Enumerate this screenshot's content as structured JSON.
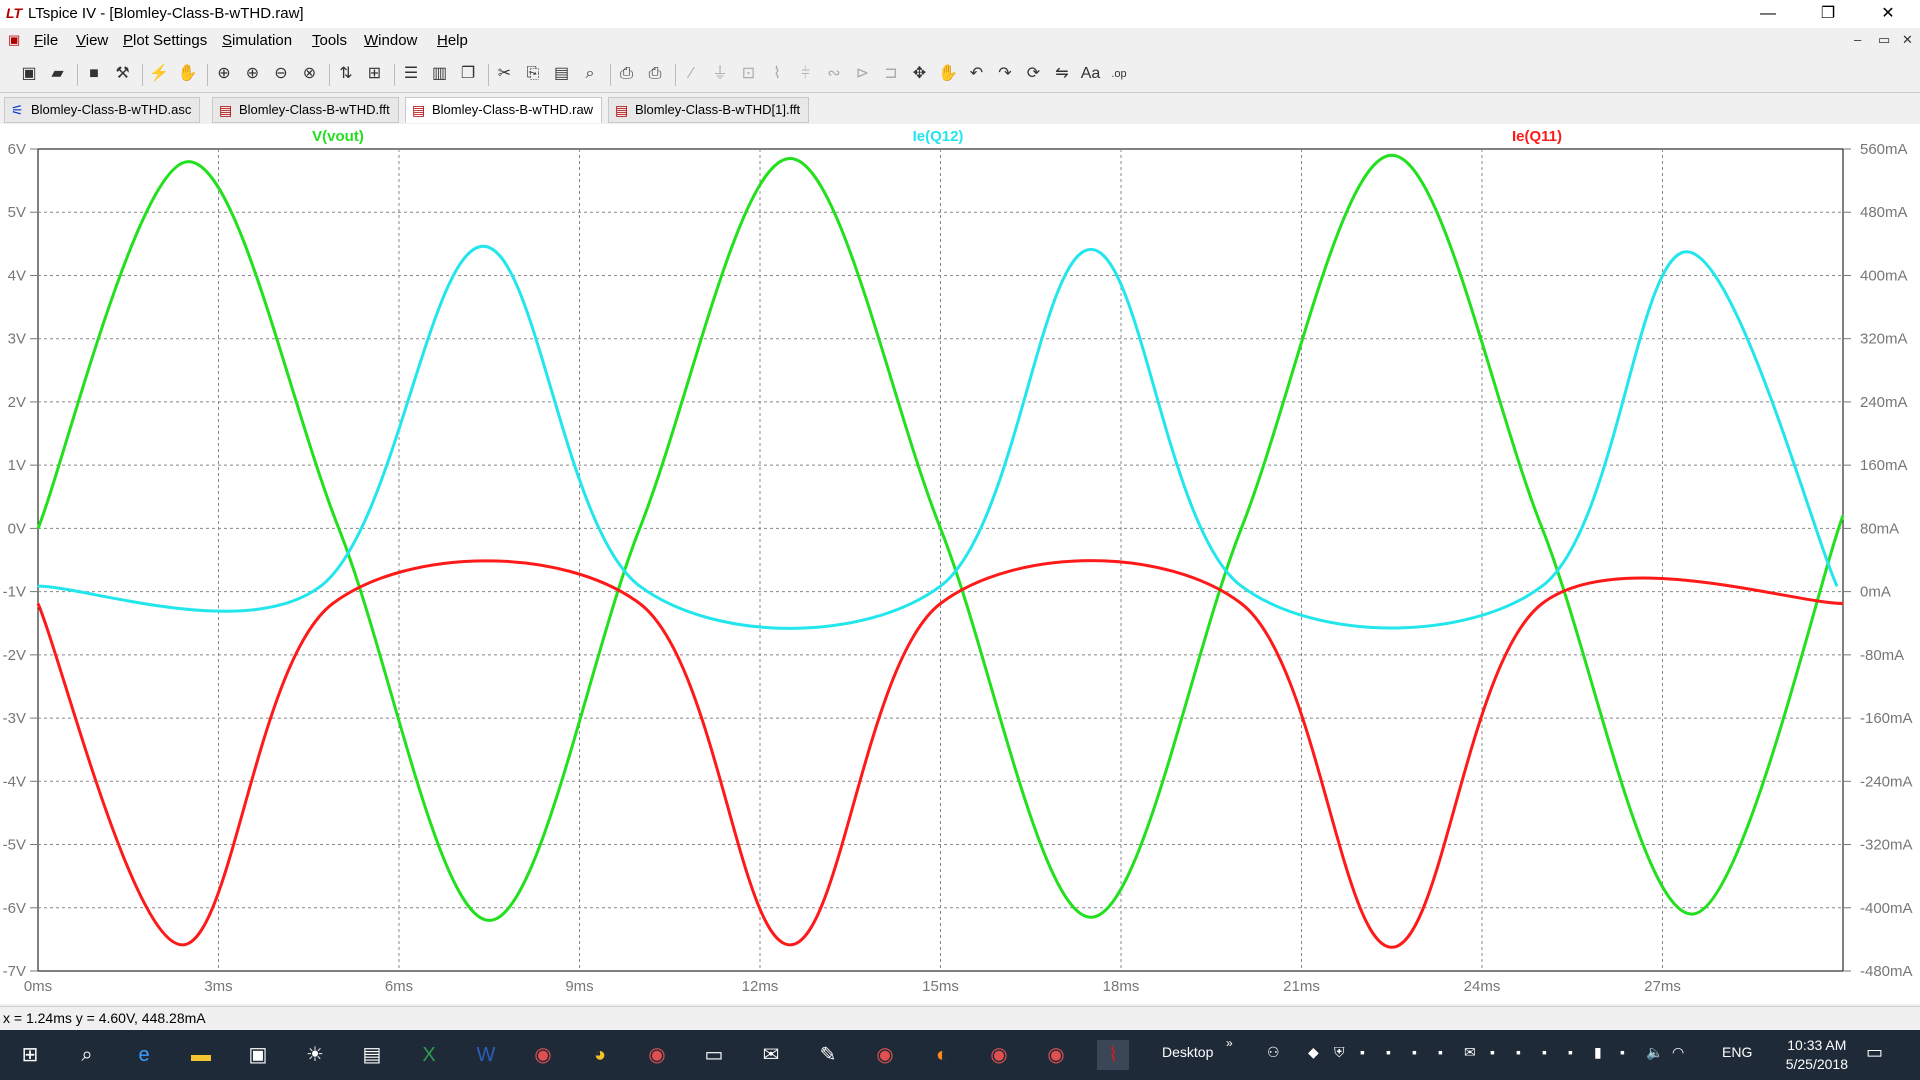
{
  "window": {
    "app_icon": "ltspice-logo-icon",
    "title": "LTspice IV - [Blomley-Class-B-wTHD.raw]",
    "controls": [
      "—",
      "❐",
      "✕"
    ]
  },
  "menu": {
    "items": [
      "File",
      "View",
      "Plot Settings",
      "Simulation",
      "Tools",
      "Window",
      "Help"
    ],
    "mdi_controls": [
      "–",
      "▭",
      "✕"
    ]
  },
  "toolbar": {
    "icons": [
      "new-schematic-icon",
      "open-icon",
      "save-icon",
      "control-panel-icon",
      "run-icon",
      "halt-icon",
      "zoom-in-icon",
      "zoom-in-icon",
      "zoom-out-icon",
      "zoom-fit-icon",
      "autorange-icon",
      "plot-pane-icon",
      "tile-horizontal-icon",
      "tile-vertical-icon",
      "cascade-icon",
      "cut-icon",
      "copy-icon",
      "paste-icon",
      "find-icon",
      "print-setup-icon",
      "print-icon",
      "wire-icon",
      "ground-icon",
      "label-icon",
      "resistor-icon",
      "capacitor-icon",
      "inductor-icon",
      "diode-icon",
      "component-icon",
      "move-icon",
      "drag-icon",
      "undo-icon",
      "redo-icon",
      "rotate-icon",
      "mirror-icon",
      "text-icon",
      "spice-directive-icon"
    ]
  },
  "tabs": [
    {
      "label": "Blomley-Class-B-wTHD.asc",
      "icon": "schematic-icon",
      "active": false
    },
    {
      "label": "Blomley-Class-B-wTHD.fft",
      "icon": "waveform-icon",
      "active": false
    },
    {
      "label": "Blomley-Class-B-wTHD.raw",
      "icon": "waveform-icon",
      "active": true
    },
    {
      "label": "Blomley-Class-B-wTHD[1].fft",
      "icon": "waveform-icon",
      "active": false
    }
  ],
  "status": {
    "cursor_readout": "x = 1.24ms    y = 4.60V, 448.28mA"
  },
  "taskbar": {
    "icons": [
      "windows-start-icon",
      "search-icon",
      "edge-icon",
      "file-explorer-icon",
      "store-icon",
      "weather-icon",
      "notepad-icon",
      "excel-icon",
      "word-icon",
      "app-icon",
      "chrome-icon",
      "app-icon",
      "remote-desktop-icon",
      "mail-icon",
      "paint-icon",
      "app-icon",
      "firefox-icon",
      "app-icon",
      "app-icon",
      "ltspice-icon"
    ],
    "desktop_label": "Desktop",
    "language": "ENG",
    "time": "10:33 AM",
    "date": "5/25/2018"
  },
  "chart_data": {
    "type": "line",
    "title": "",
    "xlabel": "",
    "ylabel": "",
    "x_ticks": [
      "0ms",
      "3ms",
      "6ms",
      "9ms",
      "12ms",
      "15ms",
      "18ms",
      "21ms",
      "24ms",
      "27ms"
    ],
    "xlim": [
      0,
      30
    ],
    "y_left_ticks": [
      "6V",
      "5V",
      "4V",
      "3V",
      "2V",
      "1V",
      "0V",
      "-1V",
      "-2V",
      "-3V",
      "-4V",
      "-5V",
      "-6V",
      "-7V"
    ],
    "ylim_left": [
      -7,
      6
    ],
    "y_right_ticks": [
      "560mA",
      "480mA",
      "400mA",
      "320mA",
      "240mA",
      "160mA",
      "80mA",
      "0mA",
      "-80mA",
      "-160mA",
      "-240mA",
      "-320mA",
      "-400mA",
      "-480mA"
    ],
    "ylim_right": [
      -480,
      560
    ],
    "grid": true,
    "legend_placement": "top",
    "series": [
      {
        "name": "V(vout)",
        "axis": "left",
        "unit": "V",
        "color": "#22e01e",
        "x": [
          0,
          2.5,
          5.0,
          7.5,
          10.0,
          12.5,
          15.0,
          17.5,
          20.0,
          22.5,
          25.0,
          27.5,
          30.0
        ],
        "y": [
          0,
          5.8,
          0,
          -6.2,
          0,
          5.85,
          0,
          -6.15,
          0,
          5.9,
          0,
          -6.1,
          0.2
        ]
      },
      {
        "name": "Ie(Q12)",
        "axis": "right",
        "unit": "mA",
        "color": "#22e6ec",
        "x": [
          0,
          4.7,
          7.4,
          10.0,
          15.0,
          17.5,
          20.0,
          25.0,
          27.4,
          29.9
        ],
        "y": [
          7,
          7,
          437,
          7,
          7,
          433,
          7,
          7,
          430,
          7
        ]
      },
      {
        "name": "Ie(Q11)",
        "axis": "right",
        "unit": "mA",
        "color": "#ff1a1a",
        "x": [
          0,
          2.4,
          4.9,
          10.0,
          12.5,
          15.0,
          20.0,
          22.5,
          25.0,
          30.0
        ],
        "y": [
          -15,
          -447,
          -15,
          -15,
          -447,
          -15,
          -15,
          -450,
          -15,
          -15
        ]
      }
    ]
  }
}
